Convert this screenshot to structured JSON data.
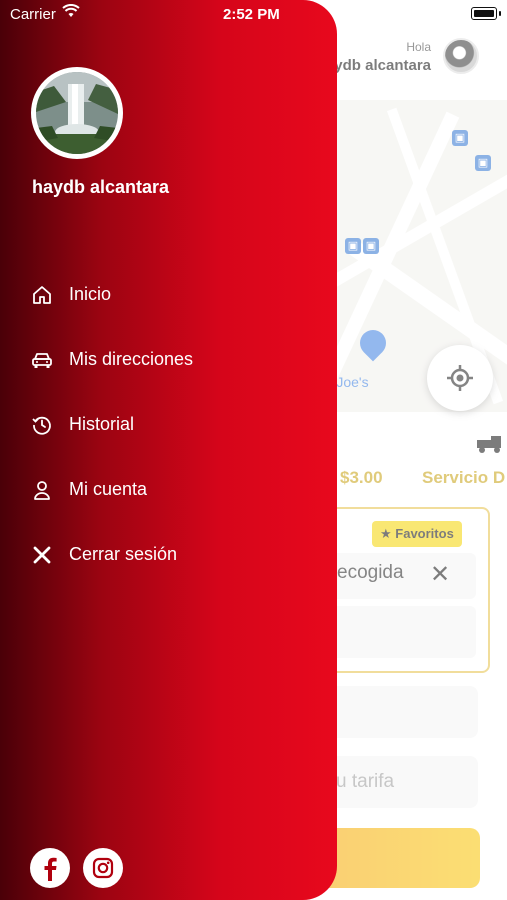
{
  "status_bar": {
    "carrier": "Carrier",
    "time": "2:52 PM"
  },
  "background": {
    "greeting": "Hola",
    "user_name": "haydb alcantara",
    "map": {
      "poi_label": "er Joe's"
    },
    "price": "$3.00",
    "service": "Servicio D",
    "favorites_badge": "Favoritos",
    "pickup_text": "ecogida",
    "fare_placeholder": "u tarifa"
  },
  "drawer": {
    "user_name": "haydb alcantara",
    "menu": [
      {
        "label": "Inicio",
        "icon": "home-icon"
      },
      {
        "label": "Mis direcciones",
        "icon": "car-icon"
      },
      {
        "label": "Historial",
        "icon": "history-icon"
      },
      {
        "label": "Mi cuenta",
        "icon": "user-icon"
      },
      {
        "label": "Cerrar sesión",
        "icon": "close-icon"
      }
    ],
    "social": [
      "facebook-icon",
      "instagram-icon"
    ]
  },
  "colors": {
    "drawer_gradient_start": "#4a0008",
    "drawer_gradient_end": "#e8081d",
    "accent_yellow": "#f5d300",
    "price_gold": "#c7a010"
  }
}
